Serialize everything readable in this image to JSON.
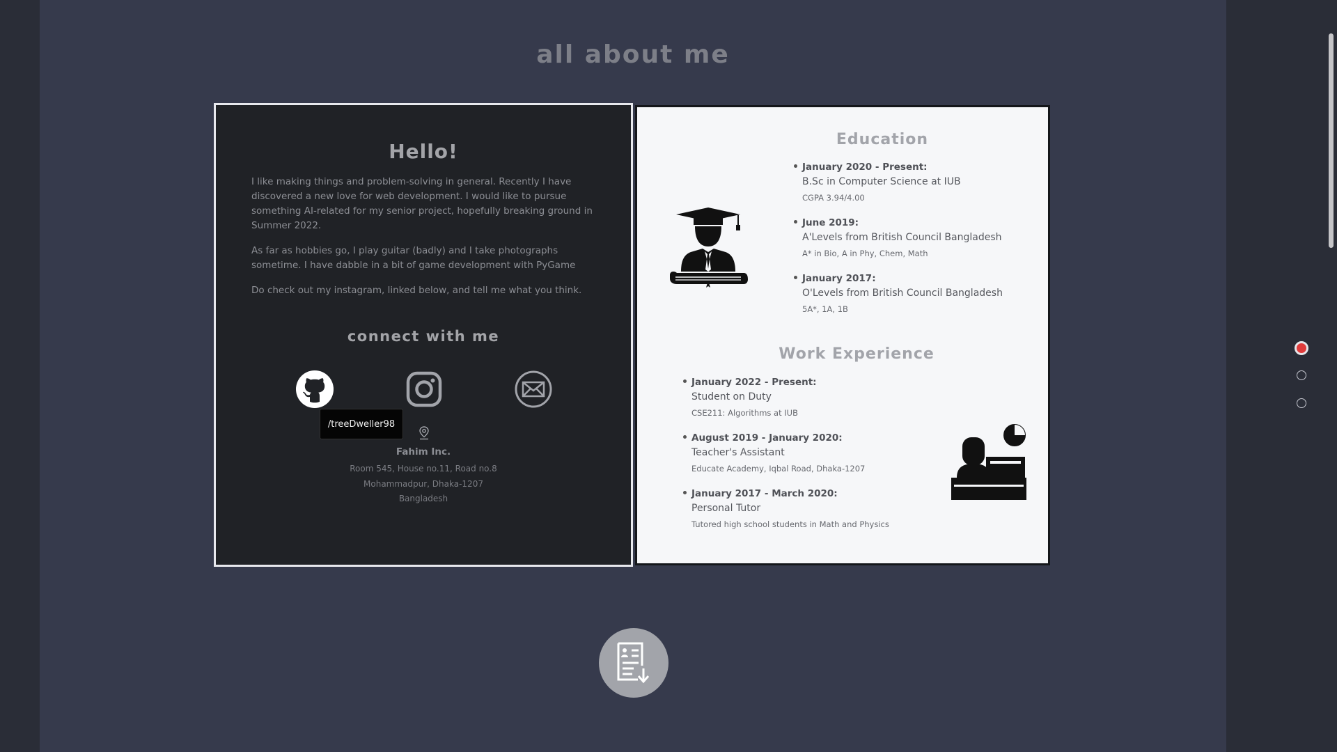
{
  "section_title": "all about me",
  "about": {
    "hello": "Hello!",
    "paragraphs": [
      "I like making things and problem-solving in general. Recently I have discovered a new love for web development. I would like to pursue something AI-related for my senior project, hopefully breaking ground in Summer 2022.",
      "As far as hobbies go, I play guitar (badly) and I take photographs sometime. I have dabble in a bit of game development with PyGame",
      "Do check out my instagram, linked below, and tell me what you think."
    ],
    "connect_title": "connect with me",
    "social": [
      {
        "icon": "github-icon"
      },
      {
        "icon": "instagram-icon"
      },
      {
        "icon": "mail-icon"
      }
    ],
    "tooltip": "/treeDweller98",
    "address": {
      "company": "Fahim Inc.",
      "lines": [
        "Room 545, House no.11, Road no.8",
        "Mohammadpur, Dhaka-1207",
        "Bangladesh"
      ]
    }
  },
  "education": {
    "title": "Education",
    "items": [
      {
        "date": "January 2020 - Present:",
        "title": "B.Sc in Computer Science at IUB",
        "note": "CGPA 3.94/4.00"
      },
      {
        "date": "June 2019:",
        "title": "A'Levels from British Council Bangladesh",
        "note": "A* in Bio, A in Phy, Chem, Math"
      },
      {
        "date": "January 2017:",
        "title": "O'Levels from British Council Bangladesh",
        "note": "5A*, 1A, 1B"
      }
    ]
  },
  "work": {
    "title": "Work Experience",
    "items": [
      {
        "date": "January 2022 - Present:",
        "title": "Student on Duty",
        "note": "CSE211: Algorithms at IUB"
      },
      {
        "date": "August 2019 - January 2020:",
        "title": "Teacher's Assistant",
        "note": "Educate Academy, Iqbal Road, Dhaka-1207"
      },
      {
        "date": "January 2017 - March 2020:",
        "title": "Personal Tutor",
        "note": "Tutored high school students in Math and Physics"
      }
    ]
  },
  "side_nav": {
    "active_index": 0,
    "count": 3
  },
  "colors": {
    "accent": "#e03b3b",
    "page_bg": "#363a4c",
    "dark_card": "#202226",
    "light_card": "#f6f7f9"
  }
}
